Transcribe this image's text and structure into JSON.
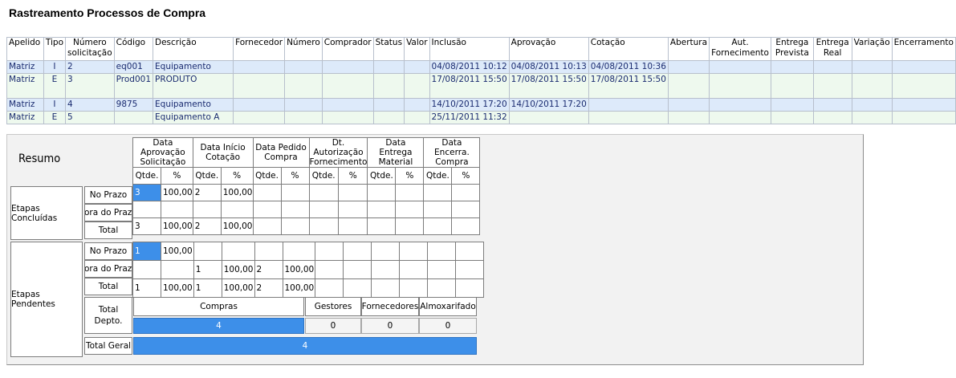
{
  "title": "Rastreamento Processos de Compra",
  "top_table": {
    "headers": [
      "Apelido",
      "Tipo",
      "Número solicitação",
      "Código",
      "Descrição",
      "Fornecedor",
      "Número",
      "Comprador",
      "Status",
      "Valor",
      "Inclusão",
      "Aprovação",
      "Cotação",
      "Abertura",
      "Aut. Fornecimento",
      "Entrega Prevista",
      "Entrega Real",
      "Variação",
      "Encerramento"
    ],
    "rows": [
      [
        "Matriz",
        "I",
        "2",
        "eq001",
        "Equipamento",
        "",
        "",
        "",
        "",
        "",
        "04/08/2011 10:12",
        "04/08/2011 10:13",
        "04/08/2011 10:36",
        "",
        "",
        "",
        "",
        "",
        ""
      ],
      [
        "Matriz",
        "E",
        "3",
        "Prod001",
        "PRODUTO",
        "",
        "",
        "",
        "",
        "",
        "17/08/2011 15:50",
        "17/08/2011 15:50",
        "17/08/2011 15:50",
        "",
        "",
        "",
        "",
        "",
        ""
      ],
      [
        "Matriz",
        "I",
        "4",
        "9875",
        "Equipamento",
        "",
        "",
        "",
        "",
        "",
        "14/10/2011 17:20",
        "14/10/2011 17:20",
        "",
        "",
        "",
        "",
        "",
        "",
        ""
      ],
      [
        "Matriz",
        "E",
        "5",
        "",
        "Equipamento A",
        "",
        "",
        "",
        "",
        "",
        "25/11/2011 11:32",
        "",
        "",
        "",
        "",
        "",
        "",
        "",
        ""
      ]
    ]
  },
  "summary": {
    "resumo_label": "Resumo",
    "group_headers": [
      "Data Aprovação Solicitação",
      "Data Início Cotação",
      "Data Pedido Compra",
      "Dt. Autorização Fornecimento",
      "Data Entrega Material",
      "Data Encerra. Compra"
    ],
    "qtde_label": "Qtde.",
    "pct_label": "%",
    "etapas_concluidas": "Etapas Concluídas",
    "etapas_pendentes": "Etapas Pendentes",
    "no_prazo": "No Prazo",
    "fora_do_prazo": "Fora do Prazo",
    "total": "Total",
    "concluidas_rows": [
      [
        "3",
        "100,00",
        "2",
        "100,00",
        "",
        "",
        "",
        "",
        "",
        "",
        "",
        ""
      ],
      [
        "",
        "",
        "",
        "",
        "",
        "",
        "",
        "",
        "",
        "",
        "",
        ""
      ],
      [
        "3",
        "100,00",
        "2",
        "100,00",
        "",
        "",
        "",
        "",
        "",
        "",
        "",
        ""
      ]
    ],
    "pendentes_rows": [
      [
        "1",
        "100,00",
        "",
        "",
        "",
        "",
        "",
        "",
        "",
        "",
        "",
        ""
      ],
      [
        "",
        "",
        "1",
        "100,00",
        "2",
        "100,00",
        "",
        "",
        "",
        "",
        "",
        ""
      ],
      [
        "1",
        "100,00",
        "1",
        "100,00",
        "2",
        "100,00",
        "",
        "",
        "",
        "",
        "",
        ""
      ]
    ],
    "total_depto_label": "Total Depto.",
    "depto_headers": [
      "Compras",
      "Gestores",
      "Fornecedores",
      "Almoxarifado"
    ],
    "depto_values": [
      "4",
      "0",
      "0",
      "0"
    ],
    "total_geral_label": "Total Geral",
    "total_geral_value": "4"
  }
}
